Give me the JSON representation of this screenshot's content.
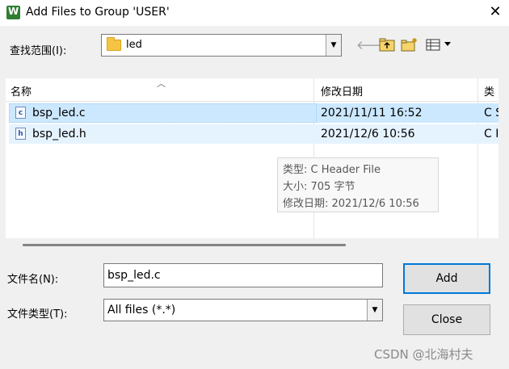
{
  "window": {
    "title": "Add Files to Group 'USER'",
    "close_glyph": "✕"
  },
  "lookin": {
    "label": "查找范围(I):",
    "value": "led"
  },
  "toolbar": {
    "icons": [
      "back-arrow-icon",
      "up-folder-icon",
      "new-folder-icon",
      "view-menu-icon"
    ]
  },
  "list": {
    "columns": [
      "名称",
      "修改日期",
      "类"
    ],
    "files": [
      {
        "name": "bsp_led.c",
        "modified": "2021/11/11 16:52",
        "type": "C S",
        "icon_letter": "c"
      },
      {
        "name": "bsp_led.h",
        "modified": "2021/12/6 10:56",
        "type": "C I",
        "icon_letter": "h"
      }
    ]
  },
  "tooltip": {
    "line1": "类型: C Header File",
    "line2": "大小: 705 字节",
    "line3": "修改日期: 2021/12/6 10:56"
  },
  "filename": {
    "label": "文件名(N):",
    "value": "bsp_led.c"
  },
  "filetype": {
    "label": "文件类型(T):",
    "value": "All files (*.*)"
  },
  "buttons": {
    "add": "Add",
    "close": "Close"
  },
  "watermark": "CSDN @北海村夫",
  "colors": {
    "selection": "#cce8ff",
    "hover": "#e5f3ff",
    "default_button_border": "#0078d7"
  }
}
